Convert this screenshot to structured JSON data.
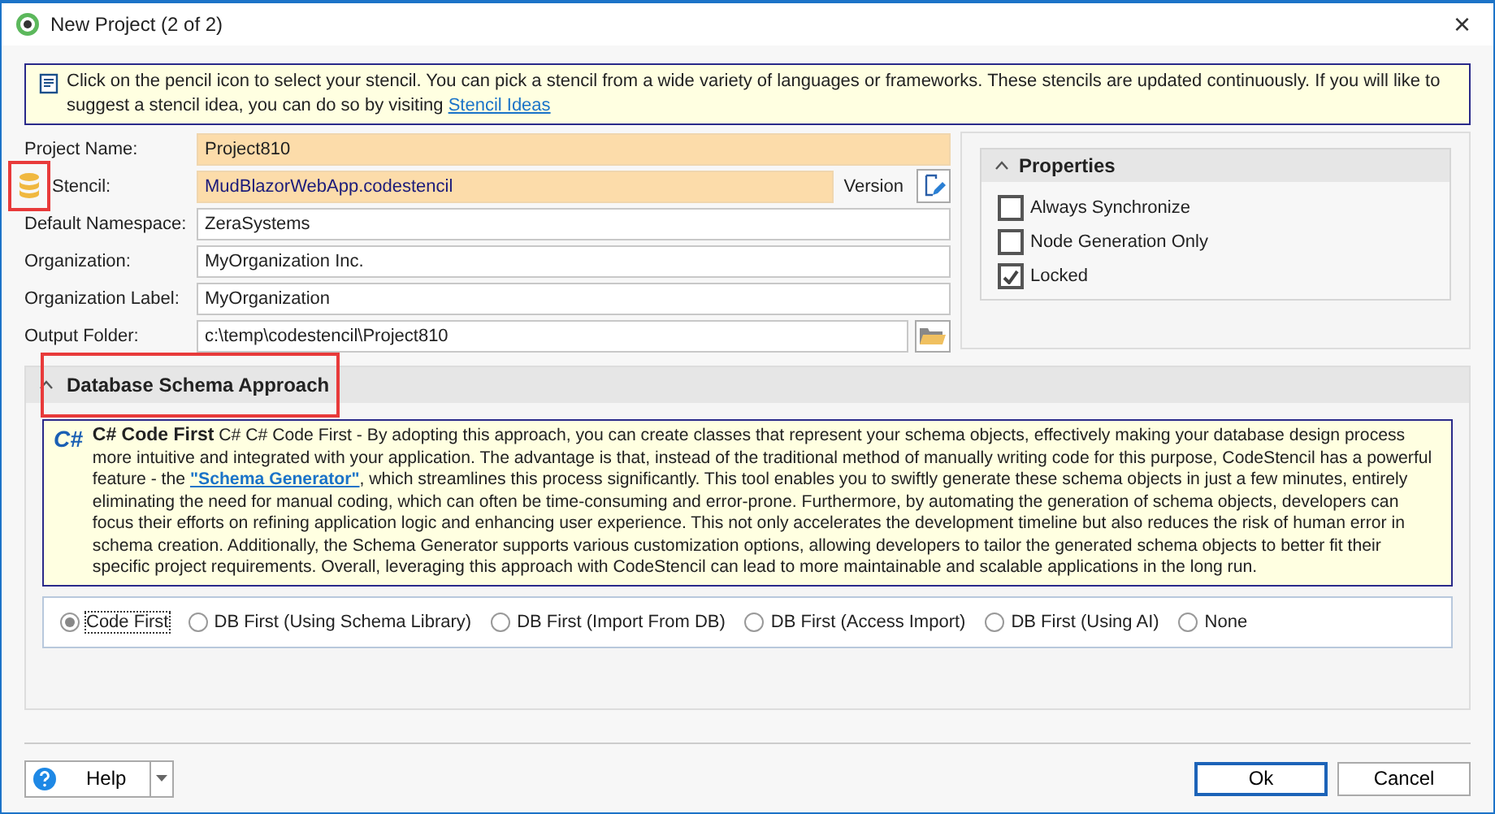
{
  "window": {
    "title": "New Project (2 of 2)",
    "close": "×"
  },
  "info": {
    "text": "Click on the pencil icon to select your stencil. You can pick a stencil from a wide variety of languages or frameworks. These stencils are updated continuously. If you will like to suggest a stencil idea, you can do so by visiting",
    "link": "Stencil Ideas"
  },
  "form": [
    {
      "kind": "text",
      "label": "Project Name:",
      "value": "Project810",
      "required": true
    },
    {
      "kind": "stencil",
      "label": "Stencil:",
      "value": "MudBlazorWebApp.codestencil",
      "required": true,
      "version_label": "Version"
    },
    {
      "kind": "text",
      "label": "Default Namespace:",
      "value": "ZeraSystems",
      "required": false
    },
    {
      "kind": "text",
      "label": "Organization:",
      "value": "MyOrganization Inc.",
      "required": false
    },
    {
      "kind": "text",
      "label": "Organization Label:",
      "value": "MyOrganization",
      "required": false
    },
    {
      "kind": "folder",
      "label": "Output Folder:",
      "value": "c:\\temp\\codestencil\\Project810",
      "required": false
    }
  ],
  "properties": {
    "title": "Properties",
    "expanded": true,
    "options": [
      {
        "label": "Always Synchronize",
        "checked": false
      },
      {
        "label": "Node Generation Only",
        "checked": false
      },
      {
        "label": "Locked",
        "checked": true
      }
    ]
  },
  "schema": {
    "title": "Database Schema Approach",
    "expanded": true,
    "description": {
      "icon_text": "C#",
      "title": "C# Code First",
      "before": "C# C# Code First - By adopting this approach, you can create classes that represent your schema objects, effectively making your database design process more intuitive and integrated with your application. The advantage is that, instead of the traditional method of manually writing code for this purpose, CodeStencil has a powerful feature - the",
      "link": "\"Schema Generator\"",
      "after": ", which streamlines this process significantly. This tool enables you to swiftly generate these schema objects in just a few minutes, entirely eliminating the need for manual coding, which can often be time-consuming and error-prone. Furthermore, by automating the generation of schema objects, developers can focus their efforts on refining application logic and enhancing user experience. This not only accelerates the development timeline but also reduces the risk of human error in schema creation. Additionally, the Schema Generator supports various customization options, allowing developers to tailor the generated schema objects to better fit their specific project requirements. Overall, leveraging this approach with CodeStencil can lead to more maintainable and scalable applications in the long run."
    },
    "options": [
      {
        "label": "Code First",
        "selected": true
      },
      {
        "label": "DB First (Using Schema Library)",
        "selected": false
      },
      {
        "label": "DB First (Import From DB)",
        "selected": false
      },
      {
        "label": "DB First (Access Import)",
        "selected": false
      },
      {
        "label": "DB First (Using AI)",
        "selected": false
      },
      {
        "label": "None",
        "selected": false
      }
    ]
  },
  "buttons": {
    "help": "Help",
    "ok": "Ok",
    "cancel": "Cancel"
  }
}
